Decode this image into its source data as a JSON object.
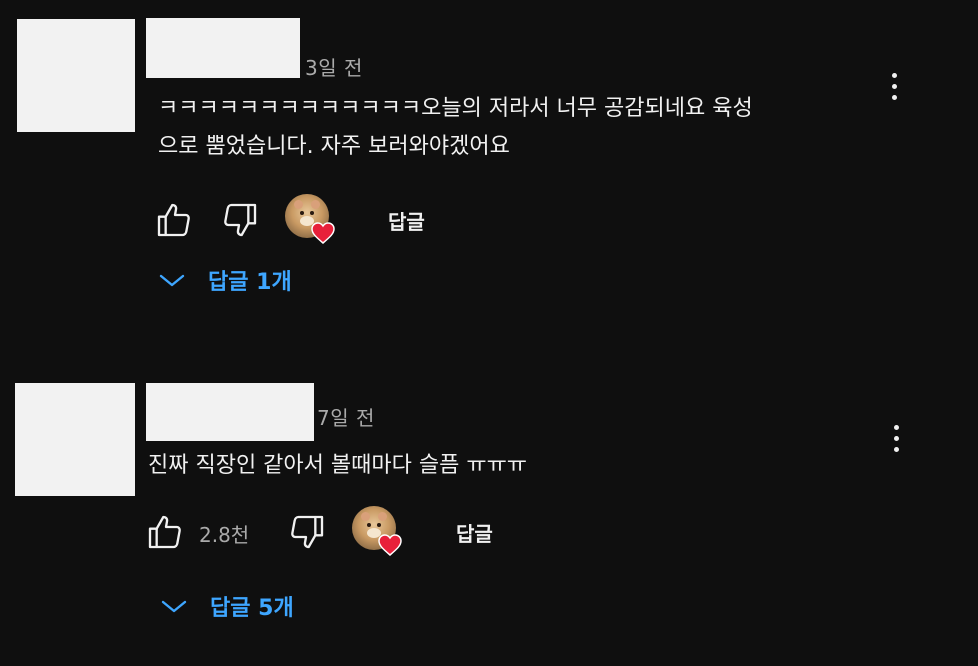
{
  "comments": [
    {
      "time": "3일 전",
      "text": "ㅋㅋㅋㅋㅋㅋㅋㅋㅋㅋㅋㅋㅋ오늘의 저라서 너무 공감되네요 육성\n으로 뿜었습니다. 자주 보러와야겠어요",
      "like_count": "",
      "reply_label": "답글",
      "replies_label": "답글 1개"
    },
    {
      "time": "7일 전",
      "text": "진짜 직장인 같아서 볼때마다 슬픔 ㅠㅠㅠ",
      "like_count": "2.8천",
      "reply_label": "답글",
      "replies_label": "답글 5개"
    }
  ],
  "icons": {
    "like": "thumb-up-icon",
    "dislike": "thumb-down-icon",
    "more": "more-vert-icon",
    "expand": "chevron-down-icon",
    "creator_heart": "heart-icon"
  },
  "colors": {
    "background": "#0f0f0f",
    "text": "#f1f1f1",
    "secondary_text": "#aaaaaa",
    "link": "#3ea6ff",
    "heart": "#e8203a"
  }
}
